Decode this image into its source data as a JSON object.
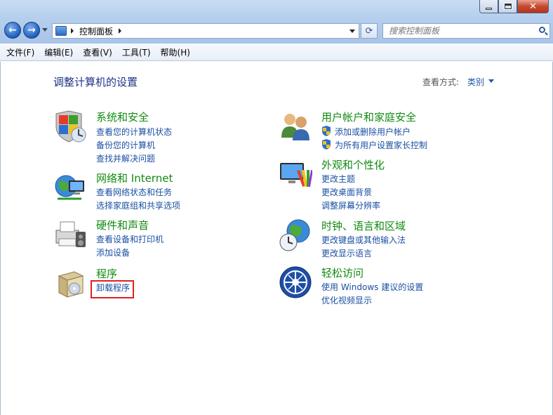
{
  "window": {
    "breadcrumb": "控制面板",
    "search_placeholder": "搜索控制面板"
  },
  "menu": [
    "文件(F)",
    "编辑(E)",
    "查看(V)",
    "工具(T)",
    "帮助(H)"
  ],
  "main": {
    "title": "调整计算机的设置",
    "view_by_label": "查看方式:",
    "view_by_value": "类别"
  },
  "categories": {
    "system": {
      "title": "系统和安全",
      "links": [
        "查看您的计算机状态",
        "备份您的计算机",
        "查找并解决问题"
      ]
    },
    "network": {
      "title": "网络和 Internet",
      "links": [
        "查看网络状态和任务",
        "选择家庭组和共享选项"
      ]
    },
    "hardware": {
      "title": "硬件和声音",
      "links": [
        "查看设备和打印机",
        "添加设备"
      ]
    },
    "programs": {
      "title": "程序",
      "links": [
        "卸载程序"
      ]
    },
    "users": {
      "title": "用户帐户和家庭安全",
      "links": [
        "添加或删除用户帐户",
        "为所有用户设置家长控制"
      ]
    },
    "appearance": {
      "title": "外观和个性化",
      "links": [
        "更改主题",
        "更改桌面背景",
        "调整屏幕分辨率"
      ]
    },
    "clock": {
      "title": "时钟、语言和区域",
      "links": [
        "更改键盘或其他输入法",
        "更改显示语言"
      ]
    },
    "ease": {
      "title": "轻松访问",
      "links": [
        "使用 Windows 建议的设置",
        "优化视频显示"
      ]
    }
  },
  "colors": {
    "category_title": "#118a11",
    "link": "#1a4fa3",
    "page_title": "#1e3287",
    "highlight": "#e02020"
  }
}
